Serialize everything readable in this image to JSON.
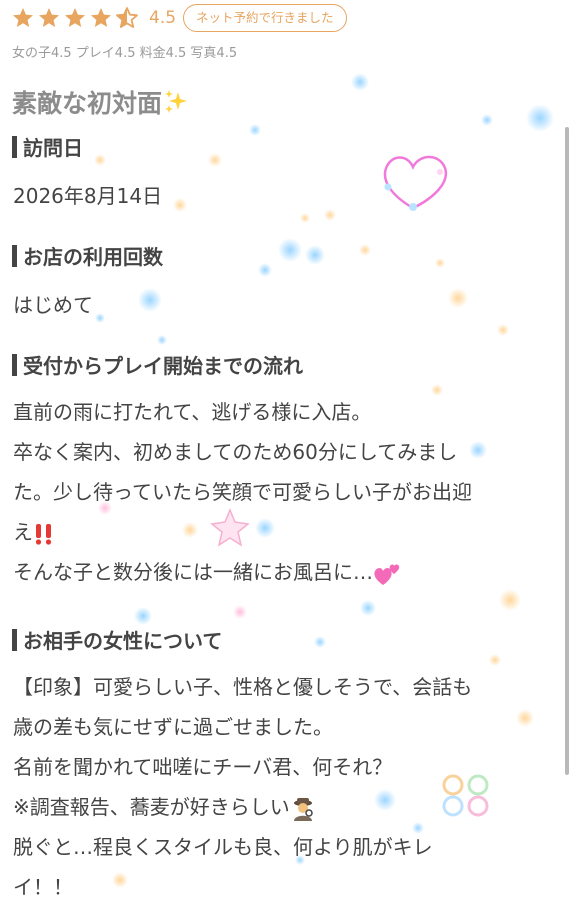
{
  "rating": {
    "stars": 4.5,
    "value": "4.5",
    "badge": "ネット予約で行きました",
    "sub": "女の子4.5 プレイ4.5 料金4.5 写真4.5"
  },
  "colors": {
    "accent": "#e7a560",
    "star": "#e7a560",
    "heading": "#444444",
    "title": "#8c8c8c"
  },
  "review": {
    "title": "素敵な初対面",
    "title_icon": "sparkles-icon",
    "sections": [
      {
        "heading": "訪問日",
        "text": "2026年8月14日"
      },
      {
        "heading": "お店の利用回数",
        "text": "はじめて"
      },
      {
        "heading": "受付からプレイ開始までの流れ",
        "lines": [
          "直前の雨に打たれて、逃げる様に入店。",
          "卒なく案内、初めましてのため60分にしてみまし",
          "た。少し待っていたら笑顔で可愛らしい子がお出迎",
          "え",
          "そんな子と数分後には一緒にお風呂に…"
        ]
      },
      {
        "heading": "お相手の女性について",
        "lines": [
          "【印象】可愛らしい子、性格と優しそうで、会話も",
          "歳の差も気にせずに過ごせました。",
          "名前を聞かれて咄嗟にチーバ君、何それ？",
          "※調査報告、蕎麦が好きらしい",
          "脱ぐと…程良くスタイルも良、何より肌がキレ",
          "イ！！"
        ]
      }
    ],
    "inline_icons": [
      "double-exclamation-icon",
      "two-hearts-icon",
      "detective-icon"
    ]
  }
}
